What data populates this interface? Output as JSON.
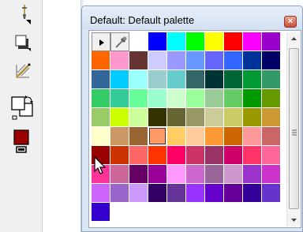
{
  "palette_window": {
    "title": "Default: Default palette",
    "close_icon": "close-icon",
    "selected_color_index": 51
  },
  "toolbox": {
    "tools": [
      "eyedropper-icon",
      "drop-shadow-icon",
      "blend-icon",
      "swap-colors-icon",
      "fill-color-icon"
    ],
    "fill_color": "#990000"
  },
  "palette": {
    "special_cells": [
      "no-color-icon",
      "eyedropper-icon"
    ],
    "colors": [
      "#ffffff",
      "#0000ff",
      "#00ffff",
      "#00ff00",
      "#ffff00",
      "#ff0000",
      "#ff00ff",
      "#9900cc",
      "#ff6600",
      "#ff99cc",
      "#663333",
      "#ccccff",
      "#9999ff",
      "#6699ff",
      "#6666ff",
      "#3366ff",
      "#003399",
      "#000066",
      "#336699",
      "#00ccff",
      "#99ffff",
      "#99cccc",
      "#66cccc",
      "#336666",
      "#003333",
      "#006633",
      "#009933",
      "#339966",
      "#33cc66",
      "#33cc99",
      "#66ff99",
      "#99ffcc",
      "#ccffcc",
      "#99ff99",
      "#99cc99",
      "#66cc66",
      "#009900",
      "#669900",
      "#99cc66",
      "#ccff00",
      "#ccff99",
      "#333300",
      "#666633",
      "#999966",
      "#cccc99",
      "#cccc66",
      "#999900",
      "#cc9933",
      "#ffffcc",
      "#cc9966",
      "#996633",
      "#ff9966",
      "#ffcc66",
      "#ffcc99",
      "#ff9933",
      "#cc6600",
      "#ff9999",
      "#cc6666",
      "#990000",
      "#cc3300",
      "#ff6666",
      "#ff3300",
      "#ff0066",
      "#cc3366",
      "#993366",
      "#cc0066",
      "#ff3366",
      "#ff6699",
      "#ff3399",
      "#cc6699",
      "#660066",
      "#990099",
      "#ff99ff",
      "#cc66cc",
      "#996699",
      "#cc99cc",
      "#9933cc",
      "#cc33cc",
      "#cc66ff",
      "#9966cc",
      "#cc99ff",
      "#330066",
      "#663399",
      "#9933ff",
      "#6600cc",
      "#660099",
      "#330099",
      "#6633cc",
      "#3300cc"
    ]
  },
  "scrollbar": {
    "up_icon": "scroll-up-arrow-icon",
    "down_icon": "scroll-down-arrow-icon"
  }
}
